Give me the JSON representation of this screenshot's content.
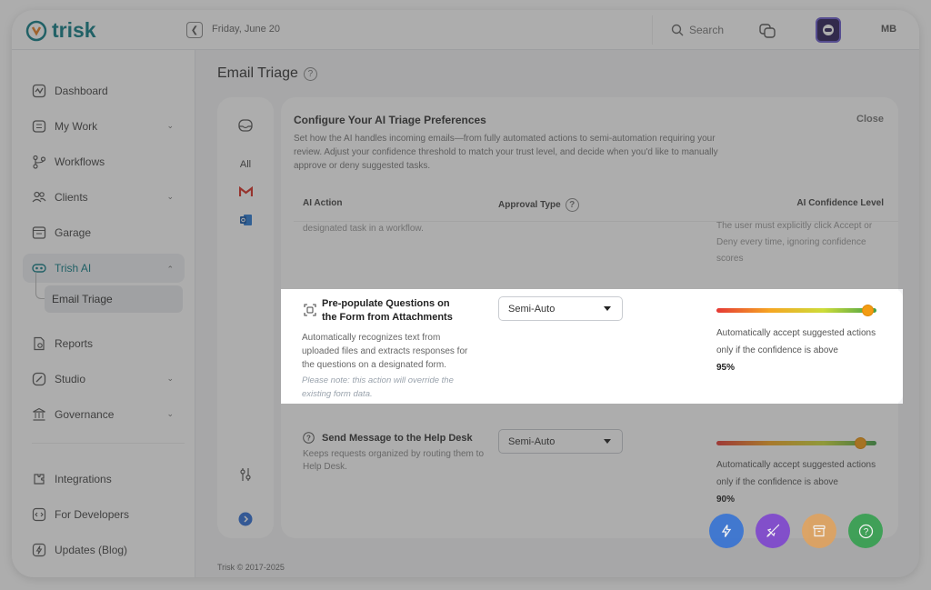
{
  "app": {
    "name": "trisk",
    "date": "Friday, June 20",
    "search_placeholder": "Search",
    "user_initials": "MB",
    "footer": "Trisk © 2017-2025"
  },
  "sidebar": {
    "items": [
      {
        "label": "Dashboard"
      },
      {
        "label": "My Work"
      },
      {
        "label": "Workflows"
      },
      {
        "label": "Clients"
      },
      {
        "label": "Garage"
      },
      {
        "label": "Trish AI"
      },
      {
        "label": "Email Triage"
      },
      {
        "label": "Reports"
      },
      {
        "label": "Studio"
      },
      {
        "label": "Governance"
      },
      {
        "label": "Integrations"
      },
      {
        "label": "For Developers"
      },
      {
        "label": "Updates (Blog)"
      }
    ]
  },
  "page": {
    "title": "Email Triage"
  },
  "sources": {
    "all_label": "All"
  },
  "panel": {
    "title": "Configure Your AI Triage Preferences",
    "close_label": "Close",
    "description": "Set how the AI handles incoming emails—from fully automated actions to semi-automation requiring your review. Adjust your confidence threshold to match your trust level, and decide when you'd like to manually approve or deny suggested tasks.",
    "columns": {
      "action": "AI Action",
      "approval": "Approval Type",
      "confidence": "AI Confidence Level"
    },
    "ghost_left": "designated task in a workflow.",
    "ghost_right_1": "The user must explicitly click Accept or",
    "ghost_right_2": "Deny every time, ignoring confidence",
    "ghost_right_3": "scores",
    "rows": [
      {
        "title": "Pre-populate Questions on the Form from Attachments",
        "description": "Automatically recognizes text from uploaded files and extracts responses for the questions on a designated form.",
        "note": "Please note: this action will override the existing form data.",
        "approval": "Semi-Auto",
        "confidence_text": "Automatically accept suggested actions only if the confidence is above",
        "confidence_value": "95%",
        "confidence_level": 95
      },
      {
        "title": "Send Message to the Help Desk",
        "description": "Keeps requests organized by routing them to Help Desk.",
        "approval": "Semi-Auto",
        "confidence_text": "Automatically accept suggested actions only if the confidence is above",
        "confidence_value": "90%",
        "confidence_level": 90
      }
    ]
  },
  "colors": {
    "brand": "#0e7c86",
    "fab_blue": "#2f6fd6",
    "fab_purple": "#7b3fd0",
    "fab_orange": "#e3a25a",
    "fab_green": "#2e9e4a"
  }
}
